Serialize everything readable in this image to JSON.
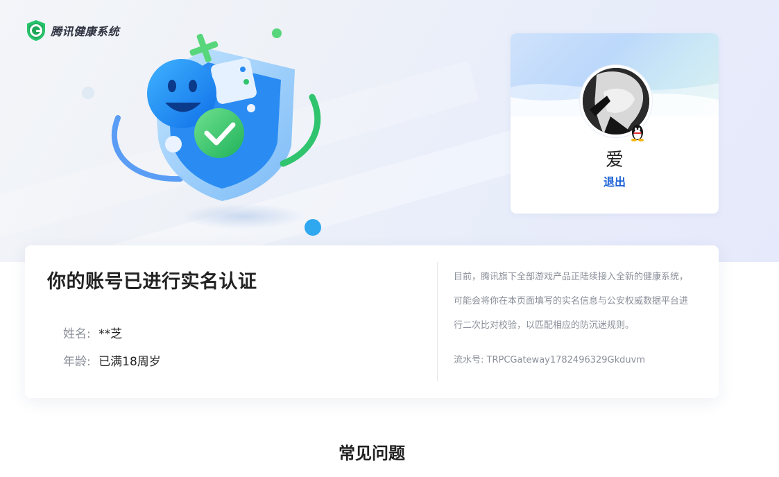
{
  "app": {
    "name": "腾讯健康系统"
  },
  "profile": {
    "nickname": "爱",
    "logout_label": "退出"
  },
  "verification": {
    "title": "你的账号已进行实名认证",
    "name_label": "姓名:",
    "name_value": "**芝",
    "age_label": "年龄:",
    "age_value": "已满18周岁",
    "notice": "目前，腾讯旗下全部游戏产品正陆续接入全新的健康系统，可能会将你在本页面填写的实名信息与公安权威数据平台进行二次比对校验，以匹配相应的防沉迷规则。",
    "serial_label": "流水号:",
    "serial_value": "TRPCGateway1782496329Gkduvm"
  },
  "faq": {
    "title": "常见问题"
  },
  "colors": {
    "accent": "#1e63d6",
    "brand_green": "#27c36b",
    "brand_blue": "#1a7cf0"
  }
}
